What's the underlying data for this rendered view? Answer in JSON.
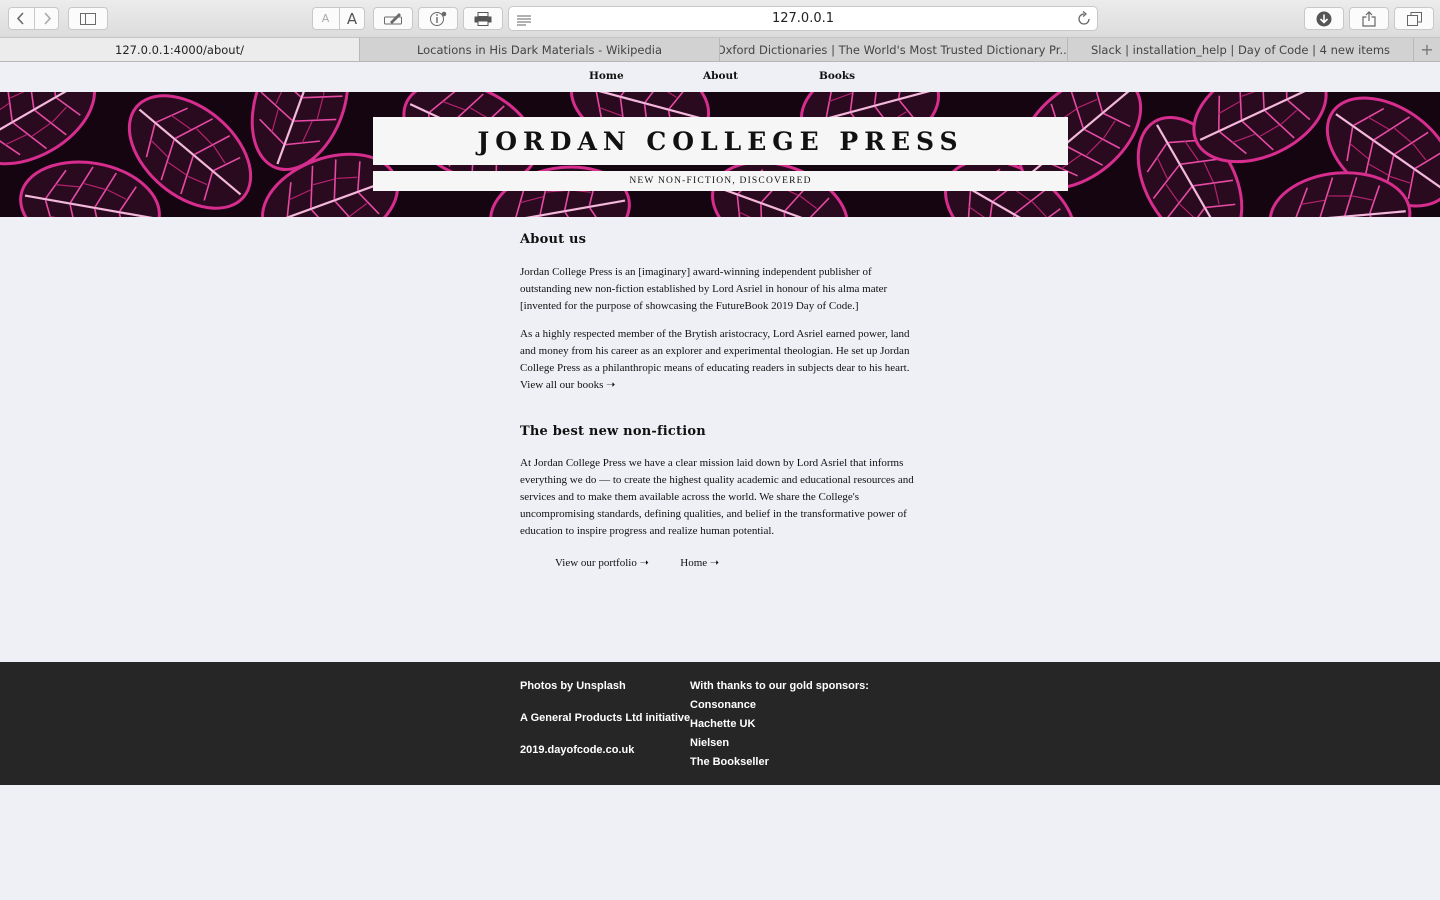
{
  "browser": {
    "url": "127.0.0.1",
    "text_small_label": "A",
    "text_large_label": "A",
    "tabs": [
      {
        "title": "127.0.0.1:4000/about/",
        "active": true
      },
      {
        "title": "Locations in His Dark Materials - Wikipedia",
        "active": false
      },
      {
        "title": "Oxford Dictionaries | The World's Most Trusted Dictionary Pr...",
        "active": false
      },
      {
        "title": "Slack | installation_help | Day of Code | 4 new items",
        "active": false
      }
    ],
    "new_tab_label": "+"
  },
  "nav": {
    "home": "Home",
    "about": "About",
    "books": "Books"
  },
  "hero": {
    "title": "JORDAN COLLEGE PRESS",
    "subtitle": "NEW NON-FICTION, DISCOVERED",
    "leaf_color": "#d62d8e"
  },
  "about": {
    "heading": "About us",
    "p1": "Jordan College Press is an [imaginary] award-winning independent publisher of outstanding new non-fiction established by Lord Asriel in honour of his alma mater [invented for the purpose of showcasing the FutureBook 2019 Day of Code.]",
    "p2": "As a highly respected member of the Brytish aristocracy, Lord Asriel earned power, land and money from his career as an explorer and experimental theologian. He set up Jordan College Press as a philanthropic means of educating readers in subjects dear to his heart.",
    "view_books": "View all our books ➝"
  },
  "best": {
    "heading": "The best new non-fiction",
    "p1": "At Jordan College Press we have a clear mission laid down by Lord Asriel that informs everything we do — to create the highest quality academic and educational resources and services and to make them available across the world. We share the College's uncompromising standards, defining qualities, and belief in the transformative power of education to inspire progress and realize human potential.",
    "portfolio_link": "View our portfolio ➝",
    "home_link": "Home ➝"
  },
  "footer": {
    "photos": "Photos by Unsplash",
    "initiative": "A General Products Ltd initiative",
    "site": "2019.dayofcode.co.uk",
    "thanks": "With thanks to our gold sponsors:",
    "sponsors": [
      "Consonance",
      "Hachette UK",
      "Nielsen",
      "The Bookseller"
    ]
  }
}
